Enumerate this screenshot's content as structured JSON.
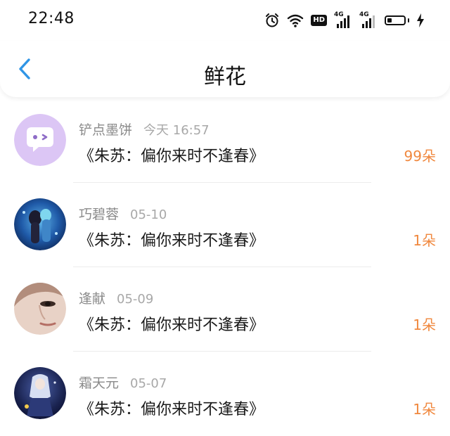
{
  "status_bar": {
    "time": "22:48",
    "icons": [
      "alarm-icon",
      "wifi-icon",
      "hd-icon",
      "signal-4g-icon",
      "signal-4g-icon",
      "battery-icon",
      "charging-icon"
    ],
    "hd_label": "HD",
    "net1_label": "4G",
    "net2_label": "4G",
    "battery_level": 0.25
  },
  "header": {
    "title": "鲜花",
    "back_icon": "chevron-left-icon"
  },
  "colors": {
    "accent_back": "#2f95e6",
    "count": "#f0883e",
    "name": "#8a8a8a"
  },
  "items": [
    {
      "name": "铲点墨饼",
      "when": "今天 16:57",
      "title": "《朱苏：偏你来时不逢春》",
      "count": "99朵",
      "avatar": "chat-bubble-avatar"
    },
    {
      "name": "巧碧蓉",
      "when": "05-10",
      "title": "《朱苏：偏你来时不逢春》",
      "count": "1朵",
      "avatar": "anime-avatar"
    },
    {
      "name": "逢献",
      "when": "05-09",
      "title": "《朱苏：偏你来时不逢春》",
      "count": "1朵",
      "avatar": "face-avatar"
    },
    {
      "name": "霜天元",
      "when": "05-07",
      "title": "《朱苏：偏你来时不逢春》",
      "count": "1朵",
      "avatar": "anime-avatar"
    }
  ]
}
